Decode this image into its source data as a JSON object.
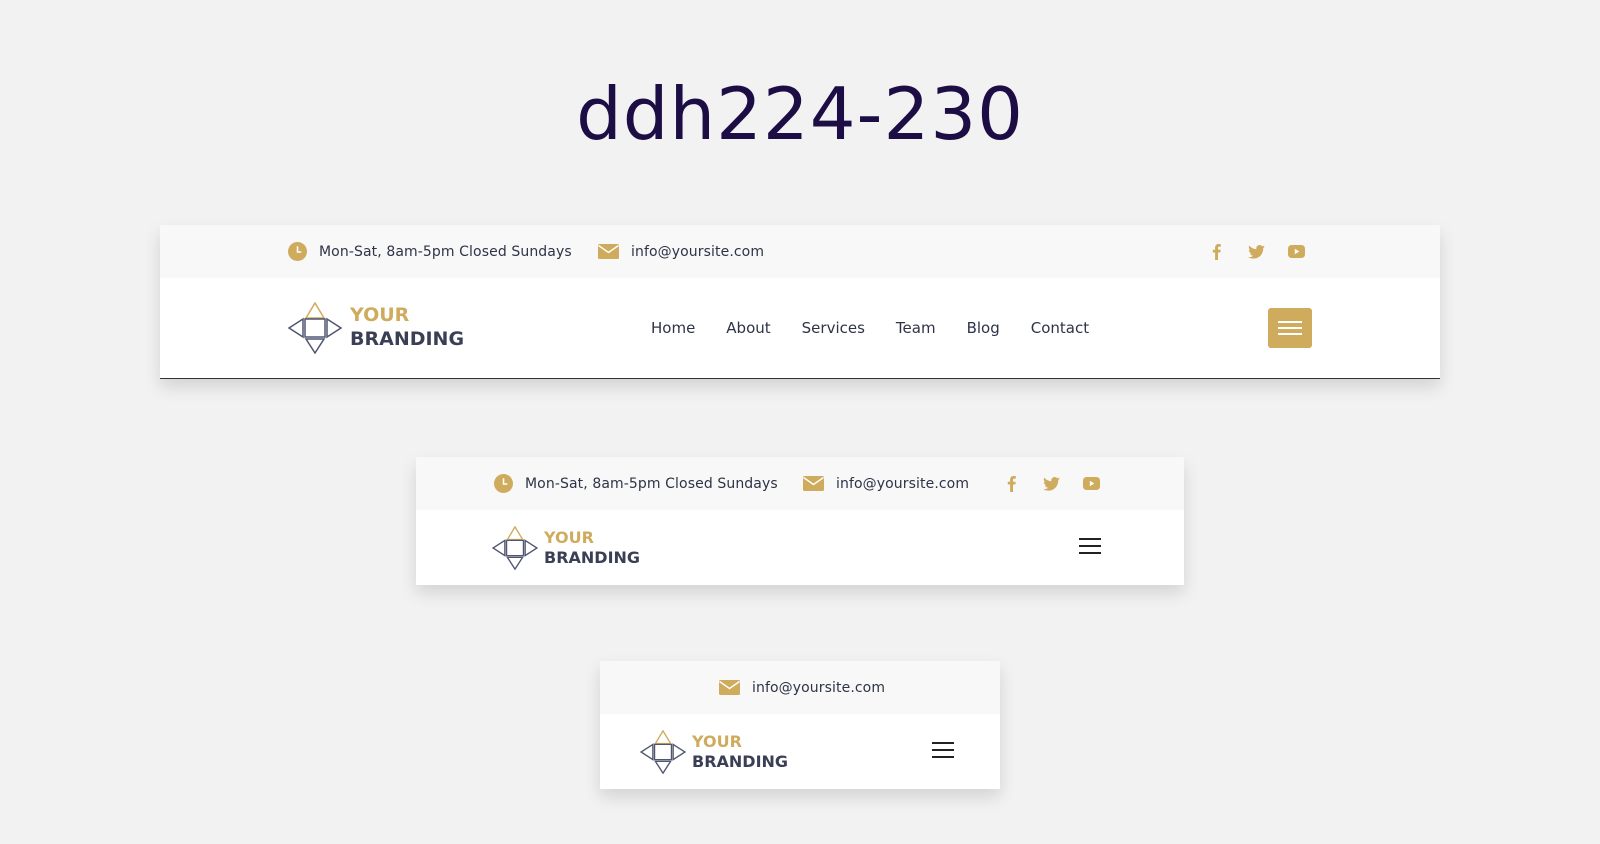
{
  "page": {
    "title": "ddh224-230"
  },
  "brand": {
    "line1": "YOUR",
    "line2": "BRANDING"
  },
  "topbar": {
    "hours": "Mon-Sat, 8am-5pm Closed Sundays",
    "email": "info@yoursite.com"
  },
  "social": [
    "facebook-icon",
    "twitter-icon",
    "youtube-icon"
  ],
  "nav": {
    "items": [
      "Home",
      "About",
      "Services",
      "Team",
      "Blog",
      "Contact"
    ]
  },
  "colors": {
    "accent": "#cfab5e",
    "dark": "#2e3347",
    "title": "#1d0d45",
    "topbar_bg": "#f8f8f8"
  }
}
